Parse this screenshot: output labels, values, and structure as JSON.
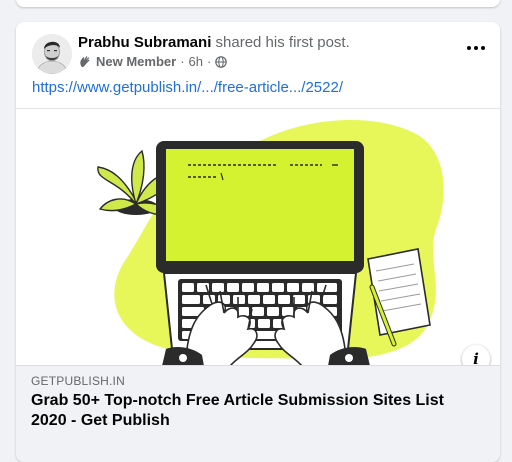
{
  "post": {
    "author_name": "Prabhu Subramani",
    "action_text": " shared his first post.",
    "badge": "New Member",
    "separator1": "·",
    "time": "6h",
    "separator2": "·",
    "audience_icon": "globe-icon",
    "link_url": "https://www.getpublish.in/.../free-article.../2522/"
  },
  "link_preview": {
    "domain": "GETPUBLISH.IN",
    "title": "Grab 50+ Top-notch Free Article Submission Sites List 2020 - Get Publish"
  },
  "colors": {
    "accent_lime": "#d4f230",
    "link_blue": "#216fdb",
    "dark": "#2b2b2b"
  }
}
